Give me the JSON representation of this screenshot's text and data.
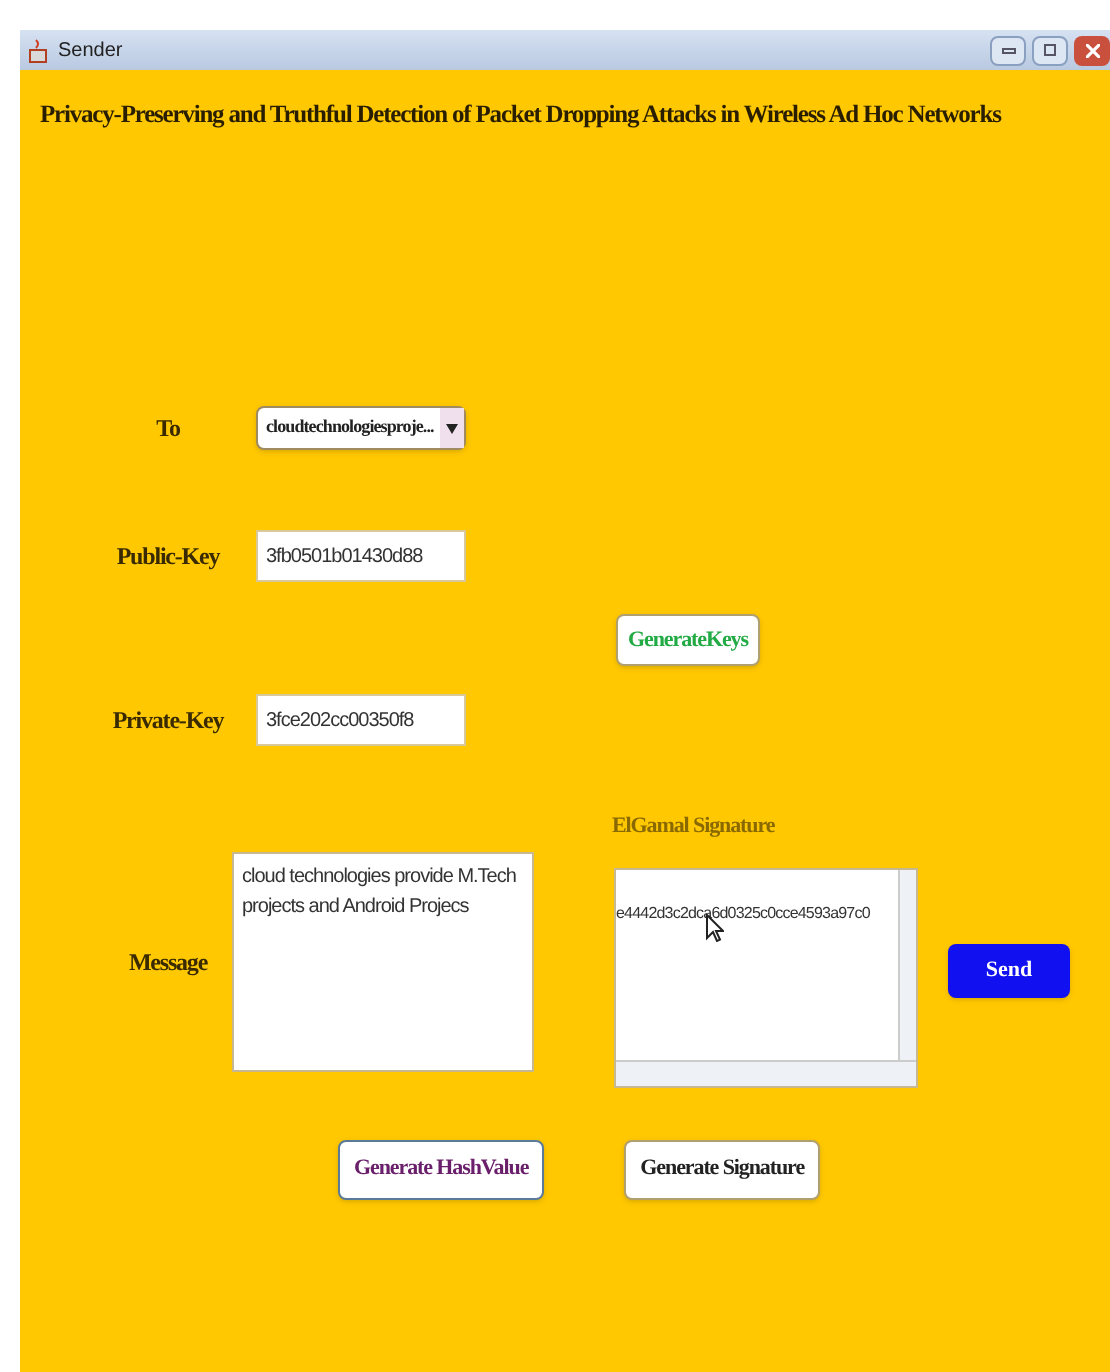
{
  "window": {
    "title": "Sender"
  },
  "heading": "Privacy-Preserving and Truthful Detection of Packet Dropping Attacks in Wireless Ad Hoc Networks",
  "to": {
    "label": "To",
    "value": "cloudtechnologiesproje..."
  },
  "public_key": {
    "label": "Public-Key",
    "value": "3fb0501b01430d88"
  },
  "generate_keys": "GenerateKeys",
  "private_key": {
    "label": "Private-Key",
    "value": "3fce202cc00350f8"
  },
  "signature": {
    "label": "ElGamal Signature",
    "value": "e4442d3c2dca6d0325c0cce4593a97c0"
  },
  "message": {
    "label": "Message",
    "value": "cloud technologies provide M.Tech projects and Android Projecs"
  },
  "send": "Send",
  "buttons": [
    {
      "kind": "hash",
      "label": "Generate HashValue"
    },
    {
      "kind": "signature",
      "label": "Generate Signature"
    }
  ]
}
